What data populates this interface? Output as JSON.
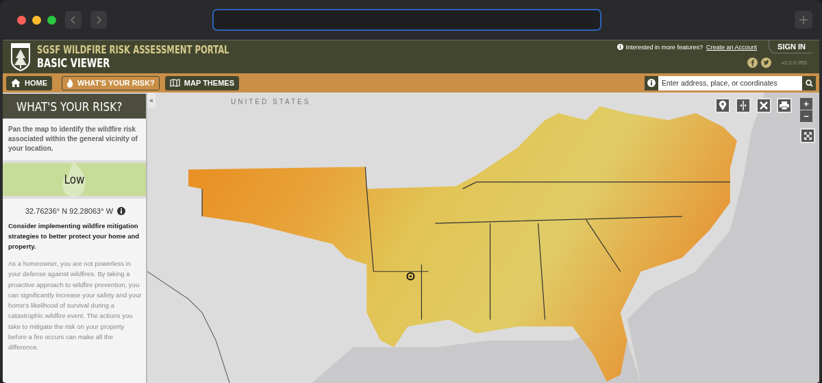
{
  "header": {
    "title": "SGSF WILDFIRE RISK ASSESSMENT PORTAL",
    "subtitle": "BASIC VIEWER",
    "prompt": "Interested in more features?",
    "account_link": "Create an Account",
    "sign_in": "SIGN IN",
    "version": "v2.2.0.955"
  },
  "nav": [
    {
      "label": "HOME",
      "kind": "home",
      "selected": false
    },
    {
      "label": "WHAT'S YOUR RISK?",
      "kind": "risk",
      "selected": true
    },
    {
      "label": "MAP THEMES",
      "kind": "themes",
      "selected": false
    }
  ],
  "search": {
    "placeholder": "Enter address, place, or coordinates"
  },
  "sidebar": {
    "title": "WHAT'S YOUR RISK?",
    "intro": "Pan the map to identify the wildfire risk associated within the general vicinity of your location.",
    "risk": "Low",
    "coordinates": "32.76236° N 92.28063° W",
    "advice": "Consider implementing wildfire mitigation strategies to better protect your home and property.",
    "body": "As a homeowner, you are not powerless in your defense against wildfires. By taking a proactive approach to wildfire prevention, you can significantly increase your safety and your home's likelihood of survival during a catastrophic wildfire event. The actions you take to mitigate the risk on your property before a fire occurs can make all the difference.",
    "collapse": "«"
  },
  "map": {
    "label": "UNITED STATES",
    "zoom_in": "+",
    "zoom_out": "−"
  }
}
